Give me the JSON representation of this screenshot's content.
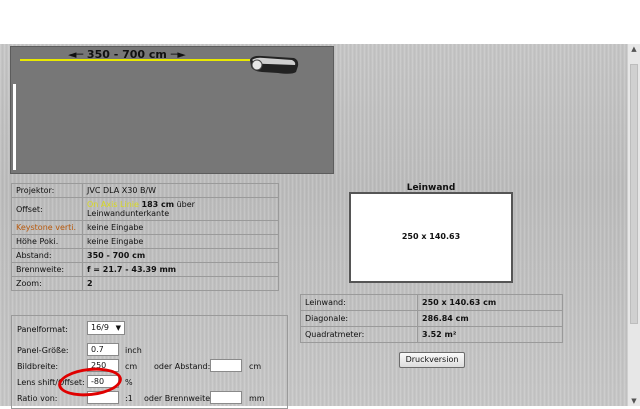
{
  "preview": {
    "distance_label": "◄─  350  -  700  cm  ─►"
  },
  "specs": [
    {
      "label": "Projektor:",
      "value": "JVC  DLA  X30  B/W"
    },
    {
      "label": "Offset:",
      "value_highlight": "On  Axis  Linie",
      "value_bold": "183  cm",
      "value_rest": "über",
      "value_line2": "Leinwandunterkante"
    },
    {
      "label": "Keystone verti.",
      "value": "keine  Eingabe"
    },
    {
      "label": "Höhe  Poki.",
      "value": "keine  Eingabe"
    },
    {
      "label": "Abstand:",
      "value": "350  -  700  cm"
    },
    {
      "label": "Brennweite:",
      "value": "f  =  21.7  -  43.39  mm"
    },
    {
      "label": "Zoom:",
      "value": "2"
    }
  ],
  "form": {
    "panelformat_label": "Panelformat:",
    "panelformat_value": "16/9",
    "panelgroesse_label": "Panel-Größe:",
    "panelgroesse_value": "0.7",
    "panelgroesse_unit": "inch",
    "bildbreite_label": "Bildbreite:",
    "bildbreite_value": "250",
    "bildbreite_unit": "cm",
    "abstand_label": "oder  Abstand:",
    "abstand_value": "",
    "abstand_unit": "cm",
    "lens_label": "Lens  shift/Offset:",
    "lens_value": "-80",
    "lens_unit": "%",
    "ratio_label": "Ratio  von:",
    "ratio_value": "",
    "ratio_sep": ":1",
    "brennweite_label": "oder  Brennweite:",
    "brennweite_value": "",
    "brennweite_unit": "mm"
  },
  "screen": {
    "title": "Leinwand",
    "size": "250  x  140.63"
  },
  "results": [
    {
      "label": "Leinwand:",
      "value": "250  x  140.63  cm"
    },
    {
      "label": "Diagonale:",
      "value": "286.84  cm"
    },
    {
      "label": "Quadratmeter:",
      "value": "3.52  m²"
    }
  ],
  "print_button": "Druckversion",
  "colors": {
    "highlight_yellow": "#d8d820",
    "keystone_orange": "#b8590c",
    "annotation_red": "#e00000"
  }
}
